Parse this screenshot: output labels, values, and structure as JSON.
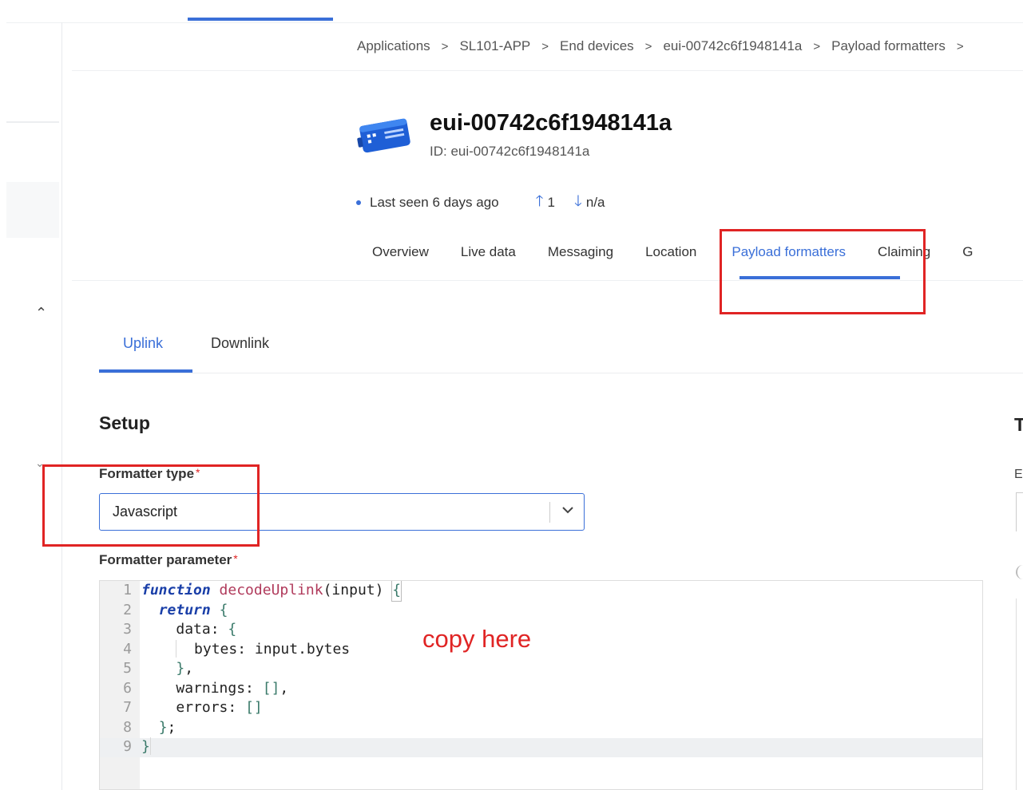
{
  "breadcrumb": {
    "items": [
      "Applications",
      "SL101-APP",
      "End devices",
      "eui-00742c6f1948141a",
      "Payload formatters"
    ],
    "separator": ">"
  },
  "device": {
    "name": "eui-00742c6f1948141a",
    "id_line": "ID: eui-00742c6f1948141a",
    "last_seen": "Last seen 6 days ago",
    "uplink_count": "1",
    "downlink_count": "n/a"
  },
  "tabs": [
    "Overview",
    "Live data",
    "Messaging",
    "Location",
    "Payload formatters",
    "Claiming",
    "G"
  ],
  "active_tab": "Payload formatters",
  "subtabs": [
    "Uplink",
    "Downlink"
  ],
  "active_subtab": "Uplink",
  "setup": {
    "title": "Setup",
    "formatter_type_label": "Formatter type",
    "formatter_type_value": "Javascript",
    "formatter_parameter_label": "Formatter parameter",
    "required_mark": "*"
  },
  "code": {
    "line_numbers": [
      "1",
      "2",
      "3",
      "4",
      "5",
      "6",
      "7",
      "8",
      "9"
    ],
    "l1_kw": "function",
    "l1_fn": "decodeUplink",
    "l1_rest": "(input) ",
    "l1_brace": "{",
    "l2_kw": "return",
    "l2_brace": "{",
    "l3_text": "data: ",
    "l3_brace": "{",
    "l4_text": "bytes: input.bytes",
    "l5_brace": "}",
    "l5_rest": ",",
    "l6_text": "warnings: ",
    "l6_arr": "[]",
    "l6_rest": ",",
    "l7_text": "errors: ",
    "l7_arr": "[]",
    "l8_brace": "}",
    "l8_rest": ";",
    "l9_brace": "}"
  },
  "annotation": {
    "copy_note": "copy here",
    "highlight_color": "#e02424"
  },
  "right_panel": {
    "title_glyph": "T",
    "label_glyph": "E"
  },
  "colors": {
    "accent": "#3a6fd8",
    "annotation_red": "#e02424"
  },
  "icons": {
    "device": "gateway-device-icon",
    "uplink": "arrow-up-icon",
    "downlink": "arrow-down-icon",
    "select": "chevron-down-icon"
  }
}
